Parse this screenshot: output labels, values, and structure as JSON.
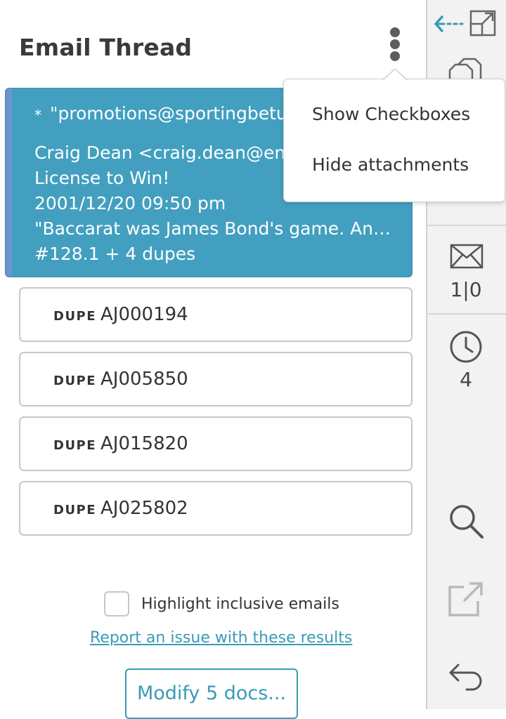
{
  "header": {
    "title": "Email Thread"
  },
  "email": {
    "subject": "\"promotions@sportingbetusa.com\"",
    "from": "Craig Dean <craig.dean@enron.com>",
    "title": "License to Win!",
    "date": "2001/12/20 09:50 pm",
    "snippet": "\"Baccarat was James Bond's game. And a...",
    "summary": "#128.1 + 4 dupes",
    "star": "*"
  },
  "dupes": [
    {
      "tag": "DUPE",
      "id": "AJ000194"
    },
    {
      "tag": "DUPE",
      "id": "AJ005850"
    },
    {
      "tag": "DUPE",
      "id": "AJ015820"
    },
    {
      "tag": "DUPE",
      "id": "AJ025802"
    }
  ],
  "footer": {
    "highlight_label": "Highlight inclusive emails",
    "report_link": "Report an issue with these results",
    "modify_button": "Modify 5 docs..."
  },
  "menu": {
    "items": [
      "Show Checkboxes",
      "Hide attachments"
    ]
  },
  "sidebar": {
    "email_count": "1|0",
    "history_count": "4",
    "icons": [
      "collapse-arrow-icon",
      "expand-icon",
      "documents-icon",
      "envelope-icon",
      "clock-icon",
      "search-icon",
      "external-link-icon",
      "undo-icon"
    ]
  },
  "colors": {
    "accent": "#3a9ab8",
    "card_bg": "#429fbf",
    "card_stripe": "#6a95cc",
    "sidebar_bg": "#f2f2f2"
  }
}
